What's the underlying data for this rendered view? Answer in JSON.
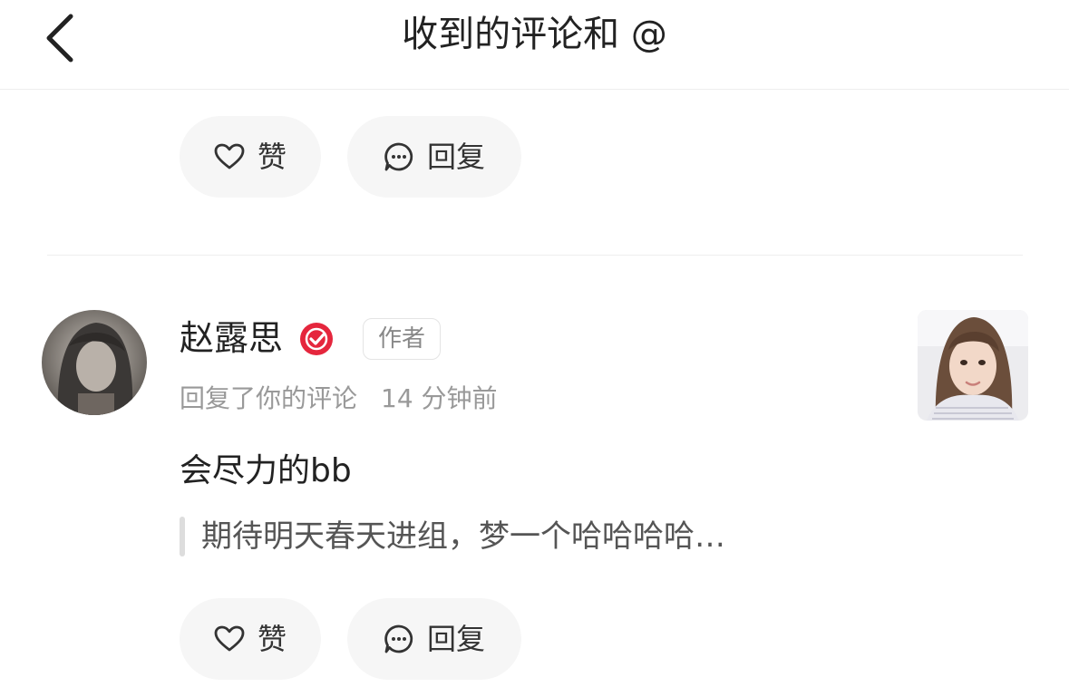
{
  "header": {
    "title": "收到的评论和 @"
  },
  "prev_item": {
    "like_label": "赞",
    "reply_label": "回复"
  },
  "item": {
    "username": "赵露思",
    "author_tag": "作者",
    "action_text": "回复了你的评论",
    "time_ago": "14 分钟前",
    "comment": "会尽力的bb",
    "quoted_comment": "期待明天春天进组，梦一个哈哈哈哈…",
    "like_label": "赞",
    "reply_label": "回复"
  },
  "colors": {
    "verified_badge": "#e5263d",
    "pill_bg": "#f6f6f6",
    "divider": "#eeeeee",
    "secondary_text": "#999999"
  }
}
